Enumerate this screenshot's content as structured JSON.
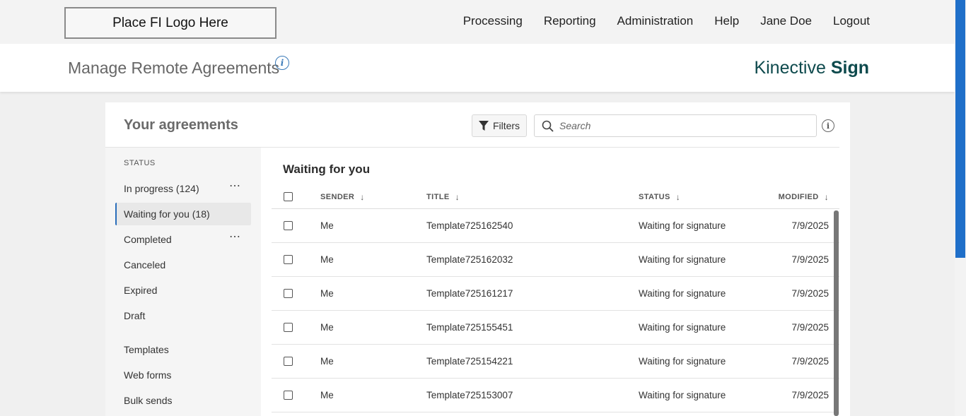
{
  "logo": {
    "text": "Place FI Logo Here"
  },
  "nav": {
    "items": [
      "Processing",
      "Reporting",
      "Administration",
      "Help",
      "Jane Doe",
      "Logout"
    ]
  },
  "header": {
    "title": "Manage Remote Agreements",
    "info_glyph": "i",
    "brand_light": "Kinective ",
    "brand_bold": "Sign"
  },
  "panel": {
    "title": "Your agreements",
    "filters_label": "Filters",
    "search_placeholder": "Search",
    "info_glyph": "i"
  },
  "sidebar": {
    "heading": "STATUS",
    "items": [
      {
        "label": "In progress (124)",
        "more": "⋯"
      },
      {
        "label": "Waiting for you (18)"
      },
      {
        "label": "Completed",
        "more": "⋯"
      },
      {
        "label": "Canceled"
      },
      {
        "label": "Expired"
      },
      {
        "label": "Draft"
      },
      {
        "label": "Templates"
      },
      {
        "label": "Web forms"
      },
      {
        "label": "Bulk sends"
      }
    ]
  },
  "table": {
    "title": "Waiting for you",
    "columns": {
      "sender": "SENDER",
      "title": "TITLE",
      "status": "STATUS",
      "modified": "MODIFIED"
    },
    "sort_glyph": "↓",
    "rows": [
      {
        "sender": "Me",
        "title": "Template725162540",
        "status": "Waiting for signature",
        "modified": "7/9/2025"
      },
      {
        "sender": "Me",
        "title": "Template725162032",
        "status": "Waiting for signature",
        "modified": "7/9/2025"
      },
      {
        "sender": "Me",
        "title": "Template725161217",
        "status": "Waiting for signature",
        "modified": "7/9/2025"
      },
      {
        "sender": "Me",
        "title": "Template725155451",
        "status": "Waiting for signature",
        "modified": "7/9/2025"
      },
      {
        "sender": "Me",
        "title": "Template725154221",
        "status": "Waiting for signature",
        "modified": "7/9/2025"
      },
      {
        "sender": "Me",
        "title": "Template725153007",
        "status": "Waiting for signature",
        "modified": "7/9/2025"
      }
    ]
  },
  "colors": {
    "accent": "#2a6ebb",
    "brand": "#0e4a4d",
    "window_scroll": "#1f6fc9"
  }
}
